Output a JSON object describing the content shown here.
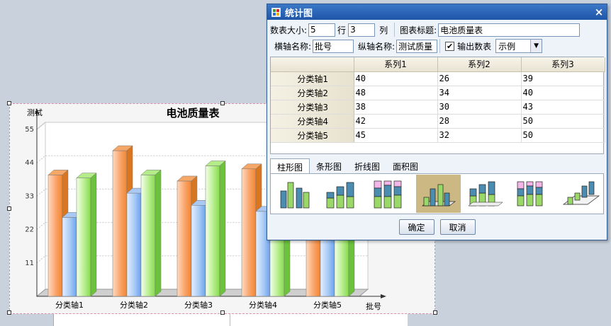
{
  "chart_dialog": {
    "title": "统计图",
    "close_label": "×",
    "table_size_label": "数表大小:",
    "rows_value": "5",
    "rows_label": "行",
    "cols_value": "3",
    "cols_label": "列",
    "chart_title_label": "图表标题:",
    "chart_title_value": "电池质量表",
    "x_axis_label": "横轴名称:",
    "x_axis_value": "批号",
    "y_axis_label": "纵轴名称:",
    "y_axis_value": "测试质量",
    "output_table_label": "输出数表",
    "output_table_checked": true,
    "legend_select_value": "示例",
    "grid": {
      "columns": [
        "",
        "系列1",
        "系列2",
        "系列3"
      ],
      "rows": [
        [
          "分类轴1",
          "40",
          "26",
          "39"
        ],
        [
          "分类轴2",
          "48",
          "34",
          "40"
        ],
        [
          "分类轴3",
          "38",
          "30",
          "43"
        ],
        [
          "分类轴4",
          "42",
          "28",
          "50"
        ],
        [
          "分类轴5",
          "45",
          "32",
          "50"
        ]
      ]
    },
    "tabs": [
      "柱形图",
      "条形图",
      "折线图",
      "面积图"
    ],
    "active_tab": "柱形图",
    "chart_styles": [
      "clustered-column",
      "stacked-column",
      "percent-stacked-column",
      "3d-clustered-column",
      "3d-stacked-column",
      "3d-percent-stacked-column",
      "3d-column"
    ],
    "selected_style": "3d-clustered-column",
    "ok_label": "确定",
    "cancel_label": "取消"
  },
  "colors": {
    "series1": "#f2893a",
    "series2": "#7aaef0",
    "series3": "#8fe05a",
    "dialog_title_bar": "#2a62b4"
  },
  "chart_data": {
    "type": "bar",
    "title": "电池质量表",
    "xlabel": "批号",
    "ylabel": "测试",
    "categories": [
      "分类轴1",
      "分类轴2",
      "分类轴3",
      "分类轴4",
      "分类轴5"
    ],
    "series": [
      {
        "values": [
          40,
          48,
          38,
          42,
          45
        ]
      },
      {
        "values": [
          26,
          34,
          30,
          28,
          32
        ]
      },
      {
        "values": [
          39,
          40,
          43,
          50,
          50
        ]
      }
    ],
    "yticks": [
      "11",
      "22",
      "33",
      "44",
      "55"
    ],
    "ylim": [
      0,
      55
    ],
    "grid": true,
    "style": "3d"
  }
}
